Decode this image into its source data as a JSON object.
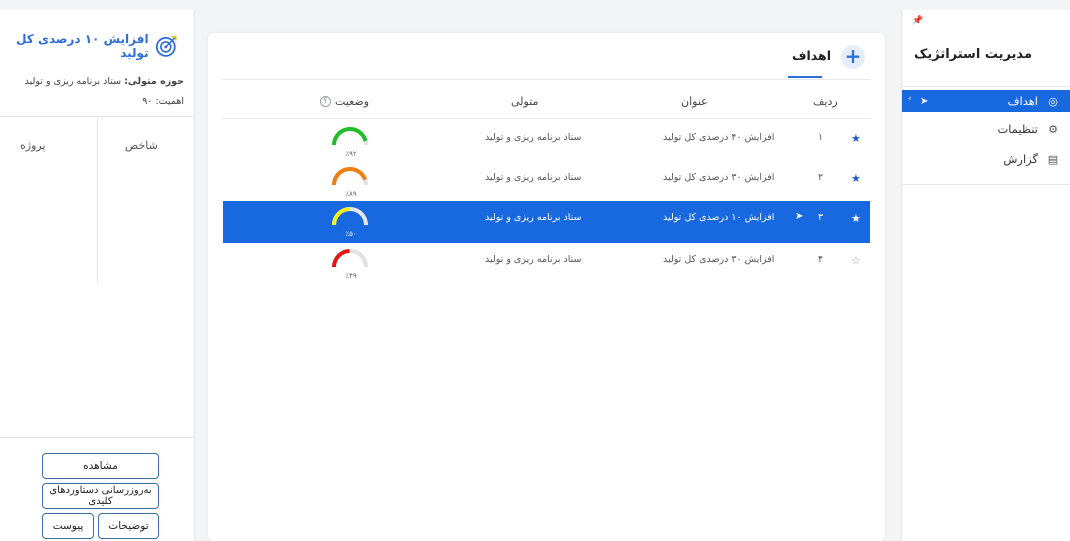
{
  "sidebar": {
    "pin_icon": "pin-icon",
    "title": "مدیریت استراتژیک",
    "items": [
      {
        "label": "اهداف",
        "icon": "target-icon",
        "active": true
      },
      {
        "label": "تنظیمات",
        "icon": "gear-icon",
        "active": false
      },
      {
        "label": "گزارش",
        "icon": "clipboard-icon",
        "active": false
      }
    ]
  },
  "main": {
    "add_icon": "plus-icon",
    "tab_title": "اهداف",
    "columns": {
      "row": "ردیف",
      "title": "عنوان",
      "owner": "متولی",
      "status": "وضعیت",
      "status_help": "؟"
    },
    "rows": [
      {
        "num": "۱",
        "title": "افزایش ۴۰ درصدی کل تولید",
        "owner": "ستاد برنامه ریزی و تولید",
        "percent_label": "٪۹۲",
        "percent": 92,
        "color": "#1fbf2a",
        "starred": true
      },
      {
        "num": "۲",
        "title": "افزایش ۳۰ درصدی کل تولید",
        "owner": "ستاد برنامه ریزی و تولید",
        "percent_label": "٪۸۹",
        "percent": 89,
        "color": "#f07d10",
        "starred": true
      },
      {
        "num": "۳",
        "title": "افزایش ۱۰ درصدی کل تولید",
        "owner": "ستاد برنامه ریزی و تولید",
        "percent_label": "٪۵۰",
        "percent": 50,
        "color": "#f5f21a",
        "starred": true,
        "selected": true
      },
      {
        "num": "۴",
        "title": "افزایش ۳۰ درصدی کل تولید",
        "owner": "ستاد برنامه ریزی و تولید",
        "percent_label": "٪۴۹",
        "percent": 49,
        "color": "#e31616",
        "starred": false
      }
    ]
  },
  "detail": {
    "title": "افزایش ۱۰ درصدی کل تولید",
    "owner_label": "حوزه متولی:",
    "owner_value": "ستاد برنامه ریزی و تولید",
    "importance_label": "اهمیت:",
    "importance_value": "۹۰",
    "col_kpi": "شاخص",
    "col_project": "پروژه",
    "buttons": {
      "view": "مشاهده",
      "update": "به‌روزرسانی دستاوردهای کلیدی",
      "description": "توضیحات",
      "attachment": "پیوست"
    }
  }
}
